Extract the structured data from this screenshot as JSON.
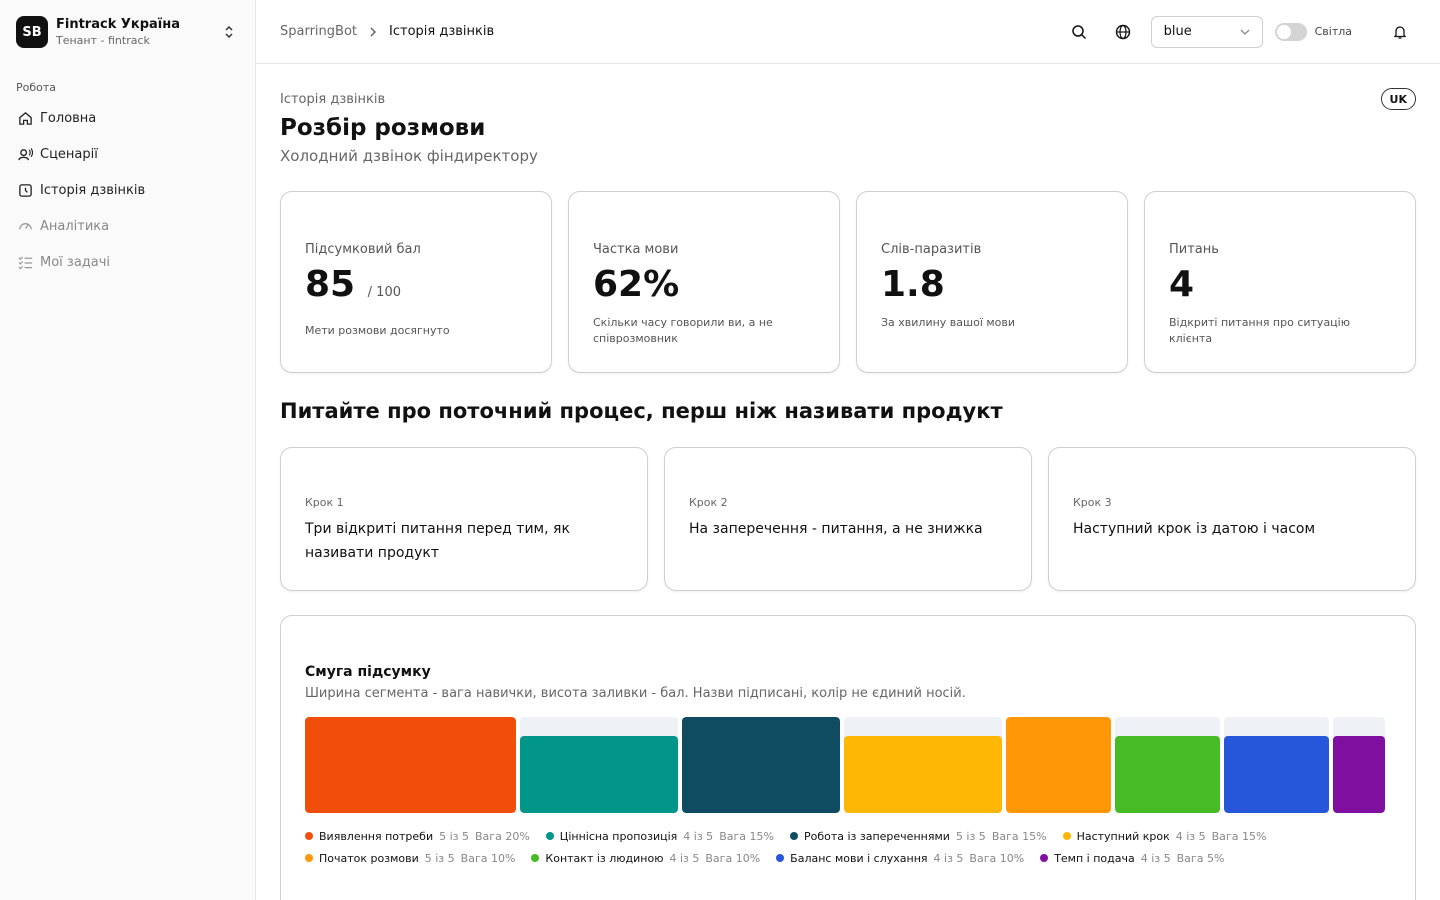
{
  "tenant": {
    "initials": "SB",
    "name": "Fintrack Україна",
    "subtitle": "Тенант - fintrack"
  },
  "sidebar": {
    "section": "Робота",
    "items": [
      {
        "label": "Головна",
        "icon": "home-icon",
        "muted": false
      },
      {
        "label": "Сценарії",
        "icon": "voice-icon",
        "muted": false
      },
      {
        "label": "Історія дзвінків",
        "icon": "history-icon",
        "muted": false
      },
      {
        "label": "Аналітика",
        "icon": "gauge-icon",
        "muted": true
      },
      {
        "label": "Мої задачі",
        "icon": "tasks-icon",
        "muted": true
      }
    ]
  },
  "header": {
    "breadcrumb_root": "SparringBot",
    "breadcrumb_current": "Історія дзвінків",
    "theme_value": "blue",
    "mode_label": "Світла"
  },
  "page": {
    "eyebrow": "Історія дзвінків",
    "title": "Розбір розмови",
    "subtitle": "Холодний дзвінок фіндиректору",
    "lang": "UK"
  },
  "stats": [
    {
      "label": "Підсумковий бал",
      "value": "85",
      "out_of": "/ 100",
      "note": "Мети розмови досягнуто"
    },
    {
      "label": "Частка мови",
      "value": "62%",
      "out_of": "",
      "note": "Скільки часу говорили ви, а не співрозмовник"
    },
    {
      "label": "Слів-паразитів",
      "value": "1.8",
      "out_of": "",
      "note": "За хвилину вашої мови"
    },
    {
      "label": "Питань",
      "value": "4",
      "out_of": "",
      "note": "Відкриті питання про ситуацію клієнта"
    }
  ],
  "advice_title": "Питайте про поточний процес, перш ніж називати продукт",
  "steps": [
    {
      "num": "Крок 1",
      "text": "Три відкриті питання перед тим, як називати продукт"
    },
    {
      "num": "Крок 2",
      "text": "На заперечення - питання, а не знижка"
    },
    {
      "num": "Крок 3",
      "text": "Наступний крок із датою і часом"
    }
  ],
  "summary": {
    "title": "Смуга підсумку",
    "subtitle": "Ширина сегмента - вага навички, висота заливки - бал. Назви підписані, колір не єдиний носій."
  },
  "chart_data": {
    "type": "bar",
    "title": "Смуга підсумку",
    "max_score": 5,
    "skills": [
      {
        "name": "Виявлення потреби",
        "score": 5,
        "weight": 20,
        "score_text": "5 із 5",
        "weight_text": "Вага 20%",
        "color": "#f04e0a"
      },
      {
        "name": "Ціннісна пропозиція",
        "score": 4,
        "weight": 15,
        "score_text": "4 із 5",
        "weight_text": "Вага 15%",
        "color": "#02968a"
      },
      {
        "name": "Робота із запереченнями",
        "score": 5,
        "weight": 15,
        "score_text": "5 із 5",
        "weight_text": "Вага 15%",
        "color": "#0f4b61"
      },
      {
        "name": "Наступний крок",
        "score": 4,
        "weight": 15,
        "score_text": "4 із 5",
        "weight_text": "Вага 15%",
        "color": "#ffb706"
      },
      {
        "name": "Початок розмови",
        "score": 5,
        "weight": 10,
        "score_text": "5 із 5",
        "weight_text": "Вага 10%",
        "color": "#ff9707"
      },
      {
        "name": "Контакт із людиною",
        "score": 4,
        "weight": 10,
        "score_text": "4 із 5",
        "weight_text": "Вага 10%",
        "color": "#46bb25"
      },
      {
        "name": "Баланс мови і слухання",
        "score": 4,
        "weight": 10,
        "score_text": "4 із 5",
        "weight_text": "Вага 10%",
        "color": "#2657db"
      },
      {
        "name": "Темп і подача",
        "score": 4,
        "weight": 5,
        "score_text": "4 із 5",
        "weight_text": "Вага 5%",
        "color": "#7f0f9e"
      }
    ]
  }
}
